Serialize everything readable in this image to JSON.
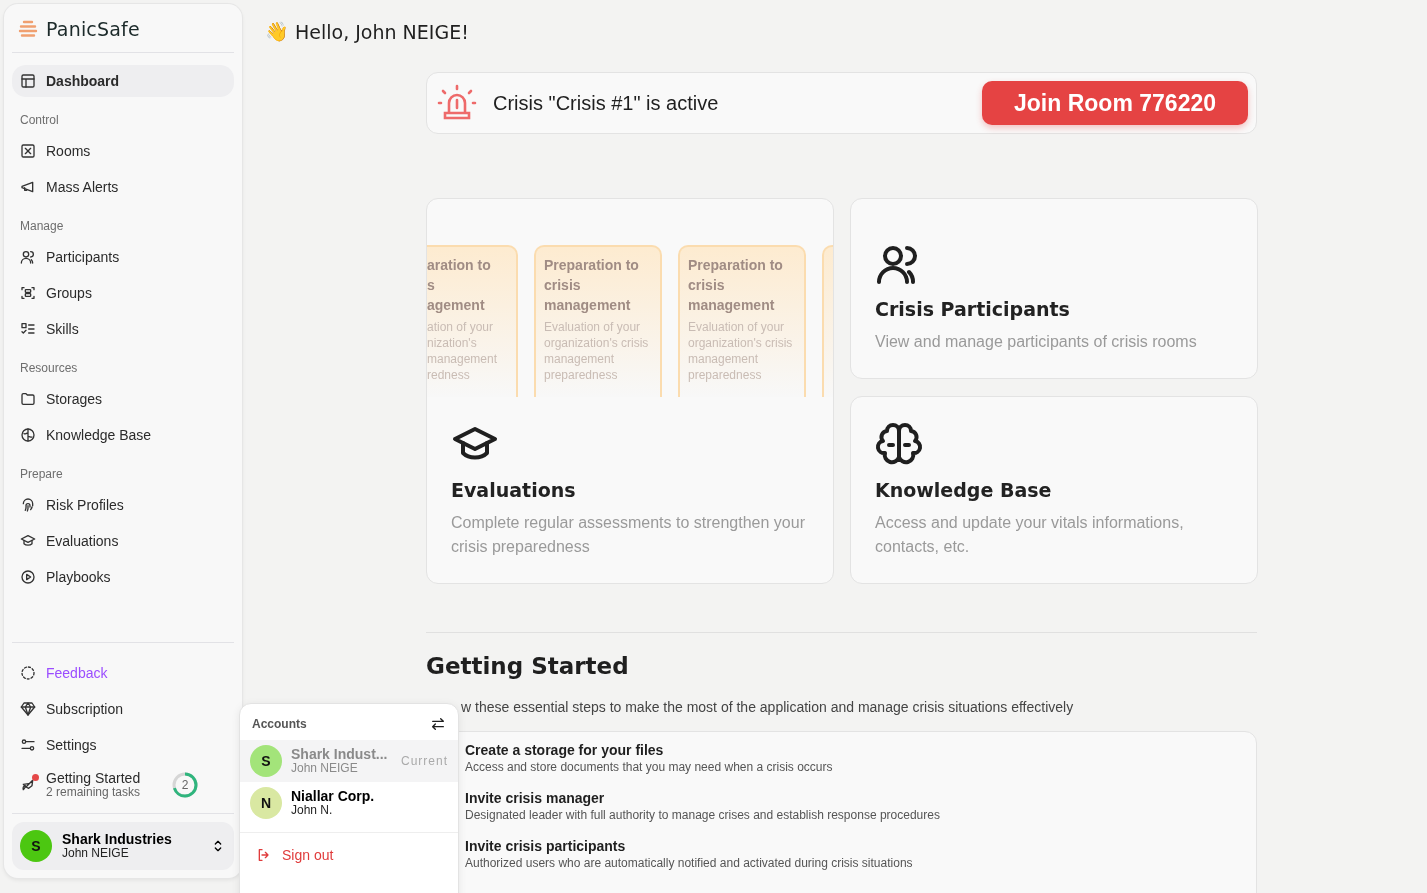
{
  "brand": {
    "name": "PanicSafe"
  },
  "nav": [
    {
      "items": [
        {
          "label": "Dashboard",
          "selected": true
        }
      ]
    },
    {
      "label": "Control",
      "items": [
        {
          "label": "Rooms",
          "selected": false
        },
        {
          "label": "Mass Alerts",
          "selected": false
        }
      ]
    },
    {
      "label": "Manage",
      "items": [
        {
          "label": "Participants",
          "selected": false
        },
        {
          "label": "Groups",
          "selected": false
        },
        {
          "label": "Skills",
          "selected": false
        }
      ]
    },
    {
      "label": "Resources",
      "items": [
        {
          "label": "Storages",
          "selected": false
        },
        {
          "label": "Knowledge Base",
          "selected": false
        }
      ]
    },
    {
      "label": "Prepare",
      "items": [
        {
          "label": "Risk Profiles",
          "selected": false
        },
        {
          "label": "Evaluations",
          "selected": false
        },
        {
          "label": "Playbooks",
          "selected": false
        }
      ]
    }
  ],
  "footer_nav": [
    {
      "kind": "feedback",
      "label": "Feedback",
      "color": "#9b4dff"
    },
    {
      "kind": "link",
      "label": "Subscription"
    },
    {
      "kind": "link",
      "label": "Settings"
    },
    {
      "kind": "progress",
      "label": "Getting Started",
      "subtitle": "2 remaining tasks",
      "count": "2",
      "badge": true
    }
  ],
  "account": {
    "initial": "S",
    "name": "Shark Industries",
    "user": "John NEIGE",
    "color": "#4cc711"
  },
  "greeting": {
    "emoji": "👋",
    "text": "Hello, John NEIGE!"
  },
  "alert": {
    "text": "Crisis \"Crisis #1\" is active",
    "button": "Join Room 776220"
  },
  "evaluations": {
    "title": "Evaluations",
    "description": "Complete regular assessments to strengthen your crisis preparedness",
    "previews": [
      {
        "kind": "partial",
        "title": "aration to\ns\nagement",
        "description": "ation of your\nnization's\n management\nredness"
      },
      {
        "kind": "full",
        "title": "Preparation to crisis management",
        "description": "Evaluation of your organization's crisis management preparedness"
      },
      {
        "kind": "full",
        "title": "Preparation to crisis management",
        "description": "Evaluation of your organization's crisis management preparedness"
      },
      {
        "kind": "sliver"
      }
    ]
  },
  "cards": [
    {
      "title": "Crisis Participants",
      "description": "View and manage participants of crisis rooms"
    },
    {
      "title": "Knowledge Base",
      "description": "Access and update your vitals informations, contacts, etc."
    }
  ],
  "getting_started": {
    "title": "Getting Started",
    "intro": "w these essential steps to make the most of the application and manage crisis situations effectively",
    "steps": [
      {
        "title": "Create a storage for your files",
        "description": "Access and store documents that you may need when a crisis occurs"
      },
      {
        "title": "Invite crisis manager",
        "description": "Designated leader with full authority to manage crises and establish response procedures"
      },
      {
        "title": "Invite crisis participants",
        "description": "Authorized users who are automatically notified and activated during crisis situations"
      }
    ]
  },
  "accounts_menu": {
    "title": "Accounts",
    "accounts": [
      {
        "initial": "S",
        "name": "Shark Indust...",
        "user": "John NEIGE",
        "color": "#a3e47a",
        "selected": true,
        "tag": "Current"
      },
      {
        "initial": "N",
        "name": "Niallar Corp.",
        "user": "John N.",
        "color": "#d9e8a2",
        "selected": false
      }
    ],
    "sign_out": "Sign out"
  }
}
